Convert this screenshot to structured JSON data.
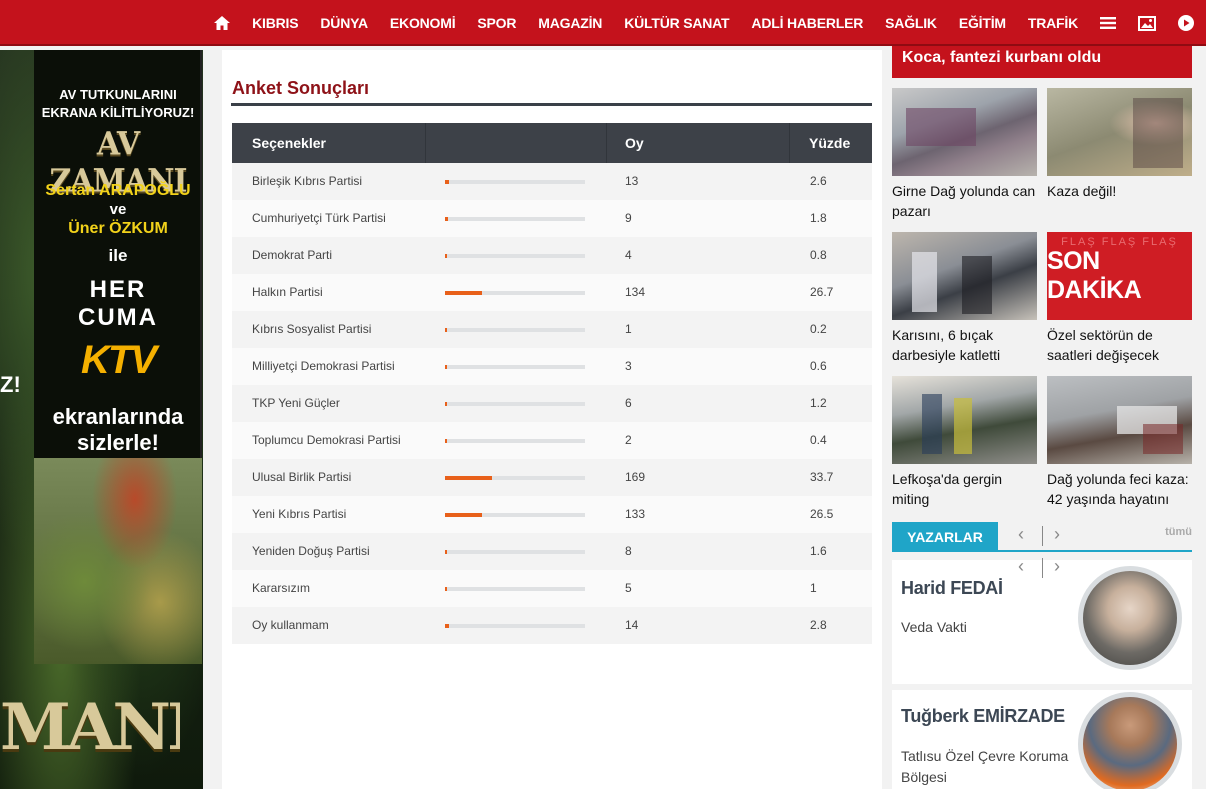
{
  "nav": {
    "items": [
      "KIBRIS",
      "DÜNYA",
      "EKONOMİ",
      "SPOR",
      "MAGAZİN",
      "KÜLTÜR SANAT",
      "ADLİ HABERLER",
      "SAĞLIK",
      "EĞİTİM",
      "TRAFİK"
    ],
    "icons": [
      "home-icon",
      "menu-icon",
      "image-icon",
      "play-icon"
    ]
  },
  "ad": {
    "line1": "AV TUTKUNLARINI",
    "line2": "EKRANA KİLİTLİYORUZ!",
    "logo": "AV ZAMANI",
    "name1": "Sertan ARAPOĞLU",
    "ve": "ve",
    "name2": "Üner ÖZKUM",
    "ile": "ile",
    "her": "HER",
    "cuma": "CUMA",
    "channel": "KTV",
    "ekran1": "ekranlarında",
    "ekran2": "sizlerle!",
    "side_z": "Z!",
    "bottom": "MANI"
  },
  "poll": {
    "title": "Anket Sonuçları",
    "headers": {
      "option": "Seçenekler",
      "votes": "Oy",
      "percent": "Yüzde"
    },
    "accent": "#e8601a",
    "rows": [
      {
        "option": "Birleşik Kıbrıs Partisi",
        "votes": "13",
        "percent": "2.6"
      },
      {
        "option": "Cumhuriyetçi Türk Partisi",
        "votes": "9",
        "percent": "1.8"
      },
      {
        "option": "Demokrat Parti",
        "votes": "4",
        "percent": "0.8"
      },
      {
        "option": "Halkın Partisi",
        "votes": "134",
        "percent": "26.7"
      },
      {
        "option": "Kıbrıs Sosyalist Partisi",
        "votes": "1",
        "percent": "0.2"
      },
      {
        "option": "Milliyetçi Demokrasi Partisi",
        "votes": "3",
        "percent": "0.6"
      },
      {
        "option": "TKP Yeni Güçler",
        "votes": "6",
        "percent": "1.2"
      },
      {
        "option": "Toplumcu Demokrasi Partisi",
        "votes": "2",
        "percent": "0.4"
      },
      {
        "option": "Ulusal Birlik Partisi",
        "votes": "169",
        "percent": "33.7"
      },
      {
        "option": "Yeni Kıbrıs Partisi",
        "votes": "133",
        "percent": "26.5"
      },
      {
        "option": "Yeniden Doğuş Partisi",
        "votes": "8",
        "percent": "1.6"
      },
      {
        "option": "Kararsızım",
        "votes": "5",
        "percent": "1"
      },
      {
        "option": "Oy kullanmam",
        "votes": "14",
        "percent": "2.8"
      }
    ]
  },
  "sidebar": {
    "headline": "Koca, fantezi kurbanı oldu",
    "news": [
      {
        "caption": "Girne Dağ yolunda can pazarı"
      },
      {
        "caption": "Kaza değil!"
      },
      {
        "caption": "Karısını, 6 bıçak darbesiyle katletti"
      },
      {
        "caption": "Özel sektörün de saatleri değişecek",
        "thumb_top": "FLAŞ FLAŞ FLAŞ",
        "thumb_text": "SON DAKİKA"
      },
      {
        "caption": "Lefkoşa'da gergin miting"
      },
      {
        "caption": "Dağ yolunda feci kaza: 42 yaşında hayatını"
      }
    ],
    "writers_tab": "YAZARLAR",
    "all_link": "tümü",
    "writers": [
      {
        "name": "Harid FEDAİ",
        "title": "Veda Vakti"
      },
      {
        "name": "Tuğberk EMİRZADE",
        "title": "Tatlısu Özel Çevre Koruma Bölgesi"
      }
    ]
  }
}
